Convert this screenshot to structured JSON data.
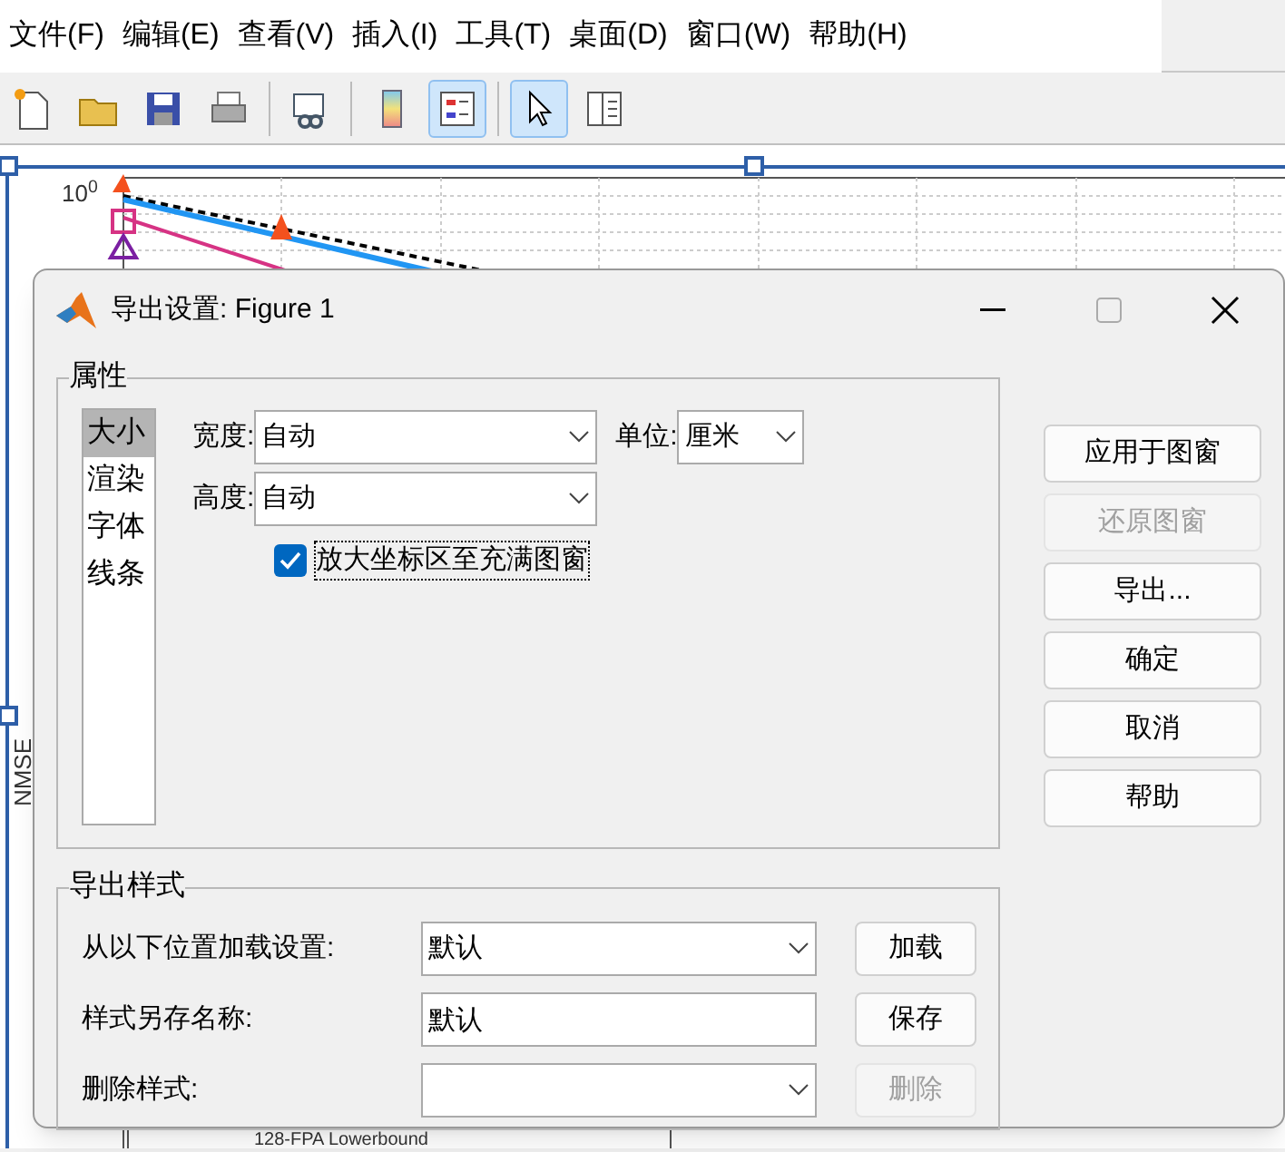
{
  "menu": [
    "文件(F)",
    "编辑(E)",
    "查看(V)",
    "插入(I)",
    "工具(T)",
    "桌面(D)",
    "窗口(W)",
    "帮助(H)"
  ],
  "toolbar": [
    {
      "kind": "new",
      "selected": false
    },
    {
      "kind": "open",
      "selected": false
    },
    {
      "kind": "save",
      "selected": false
    },
    {
      "kind": "print",
      "selected": false
    },
    {
      "kind": "link",
      "selected": false
    },
    {
      "kind": "colorbar",
      "selected": false
    },
    {
      "kind": "legend",
      "selected": true
    },
    {
      "kind": "pointer",
      "selected": true
    },
    {
      "kind": "property",
      "selected": false
    }
  ],
  "plot": {
    "ytick": "10$^{0}$",
    "ylabel": "NMSE",
    "legend_entry": "128-FPA Lowerbound"
  },
  "dialog": {
    "title": "导出设置: Figure 1",
    "properties": {
      "label": "属性",
      "categories": [
        {
          "label": "大小",
          "selected": true
        },
        {
          "label": "渲染",
          "selected": false
        },
        {
          "label": "字体",
          "selected": false
        },
        {
          "label": "线条",
          "selected": false
        }
      ],
      "width": {
        "label": "宽度:",
        "value": "自动"
      },
      "unit": {
        "label": "单位:",
        "value": "厘米"
      },
      "height": {
        "label": "高度:",
        "value": "自动"
      },
      "expand_axes": {
        "label": "放大坐标区至充满图窗",
        "checked": true
      }
    },
    "buttons": [
      {
        "label": "应用于图窗",
        "disabled": false
      },
      {
        "label": "还原图窗",
        "disabled": true
      },
      {
        "label": "导出...",
        "disabled": false
      },
      {
        "label": "确定",
        "disabled": false
      },
      {
        "label": "取消",
        "disabled": false
      },
      {
        "label": "帮助",
        "disabled": false
      }
    ],
    "export_style": {
      "label": "导出样式",
      "rows": [
        {
          "label": "从以下位置加载设置:",
          "kind": "dropdown",
          "value": "默认",
          "button": "加载",
          "button_disabled": false
        },
        {
          "label": "样式另存名称:",
          "kind": "text",
          "value": "默认",
          "button": "保存",
          "button_disabled": false
        },
        {
          "label": "删除样式:",
          "kind": "dropdown",
          "value": "",
          "button": "删除",
          "button_disabled": true
        }
      ]
    }
  }
}
